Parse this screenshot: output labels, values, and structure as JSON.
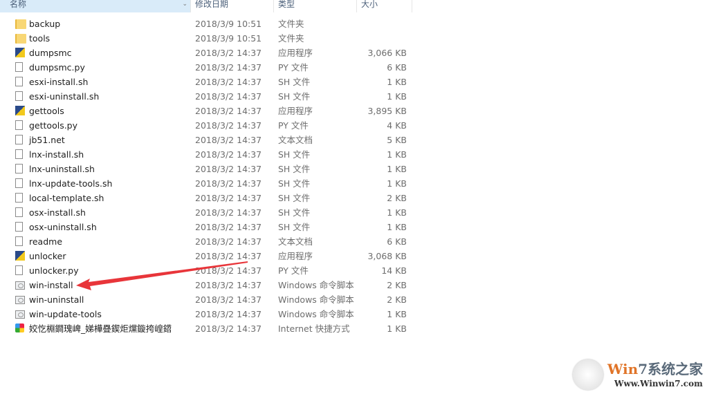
{
  "columns": {
    "name": "名称",
    "date": "修改日期",
    "type": "类型",
    "size": "大小"
  },
  "files": [
    {
      "name": "backup",
      "date": "2018/3/9 10:51",
      "type": "文件夹",
      "size": "",
      "icon": "folder"
    },
    {
      "name": "tools",
      "date": "2018/3/9 10:51",
      "type": "文件夹",
      "size": "",
      "icon": "folder"
    },
    {
      "name": "dumpsmc",
      "date": "2018/3/2 14:37",
      "type": "应用程序",
      "size": "3,066 KB",
      "icon": "app"
    },
    {
      "name": "dumpsmc.py",
      "date": "2018/3/2 14:37",
      "type": "PY 文件",
      "size": "6 KB",
      "icon": "file"
    },
    {
      "name": "esxi-install.sh",
      "date": "2018/3/2 14:37",
      "type": "SH 文件",
      "size": "1 KB",
      "icon": "file"
    },
    {
      "name": "esxi-uninstall.sh",
      "date": "2018/3/2 14:37",
      "type": "SH 文件",
      "size": "1 KB",
      "icon": "file"
    },
    {
      "name": "gettools",
      "date": "2018/3/2 14:37",
      "type": "应用程序",
      "size": "3,895 KB",
      "icon": "app"
    },
    {
      "name": "gettools.py",
      "date": "2018/3/2 14:37",
      "type": "PY 文件",
      "size": "4 KB",
      "icon": "file"
    },
    {
      "name": "jb51.net",
      "date": "2018/3/2 14:37",
      "type": "文本文档",
      "size": "5 KB",
      "icon": "file"
    },
    {
      "name": "lnx-install.sh",
      "date": "2018/3/2 14:37",
      "type": "SH 文件",
      "size": "1 KB",
      "icon": "file"
    },
    {
      "name": "lnx-uninstall.sh",
      "date": "2018/3/2 14:37",
      "type": "SH 文件",
      "size": "1 KB",
      "icon": "file"
    },
    {
      "name": "lnx-update-tools.sh",
      "date": "2018/3/2 14:37",
      "type": "SH 文件",
      "size": "1 KB",
      "icon": "file"
    },
    {
      "name": "local-template.sh",
      "date": "2018/3/2 14:37",
      "type": "SH 文件",
      "size": "2 KB",
      "icon": "file"
    },
    {
      "name": "osx-install.sh",
      "date": "2018/3/2 14:37",
      "type": "SH 文件",
      "size": "1 KB",
      "icon": "file"
    },
    {
      "name": "osx-uninstall.sh",
      "date": "2018/3/2 14:37",
      "type": "SH 文件",
      "size": "1 KB",
      "icon": "file"
    },
    {
      "name": "readme",
      "date": "2018/3/2 14:37",
      "type": "文本文档",
      "size": "6 KB",
      "icon": "file"
    },
    {
      "name": "unlocker",
      "date": "2018/3/2 14:37",
      "type": "应用程序",
      "size": "3,068 KB",
      "icon": "app"
    },
    {
      "name": "unlocker.py",
      "date": "2018/3/2 14:37",
      "type": "PY 文件",
      "size": "14 KB",
      "icon": "file"
    },
    {
      "name": "win-install",
      "date": "2018/3/2 14:37",
      "type": "Windows 命令脚本",
      "size": "2 KB",
      "icon": "bat"
    },
    {
      "name": "win-uninstall",
      "date": "2018/3/2 14:37",
      "type": "Windows 命令脚本",
      "size": "2 KB",
      "icon": "bat"
    },
    {
      "name": "win-update-tools",
      "date": "2018/3/2 14:37",
      "type": "Windows 命令脚本",
      "size": "1 KB",
      "icon": "bat"
    },
    {
      "name": "姣忔棩鐧瑰崥_娣樺疂鍥炬爣鏇挎崲鍣",
      "date": "2018/3/2 14:37",
      "type": "Internet 快捷方式",
      "size": "1 KB",
      "icon": "url"
    }
  ],
  "annotation": {
    "arrow_color": "#e8353a",
    "target": "win-install"
  },
  "watermark": {
    "brand_a": "Win",
    "brand_b": "7系统之家",
    "url": "Www.Winwin7.com"
  }
}
